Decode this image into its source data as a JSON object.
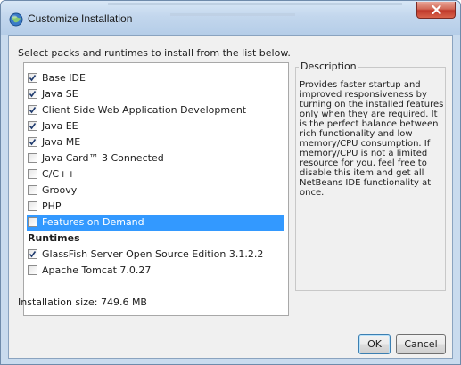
{
  "window": {
    "title": "Customize Installation",
    "app_icon": "globe-icon",
    "close_icon": "close-icon"
  },
  "instructions": "Select packs and runtimes to install from the list below.",
  "packs": [
    {
      "label": "Base IDE",
      "checked": true
    },
    {
      "label": "Java SE",
      "checked": true
    },
    {
      "label": "Client Side Web Application Development",
      "checked": true
    },
    {
      "label": "Java EE",
      "checked": true
    },
    {
      "label": "Java ME",
      "checked": true
    },
    {
      "label": "Java Card™ 3 Connected",
      "checked": false
    },
    {
      "label": "C/C++",
      "checked": false
    },
    {
      "label": "Groovy",
      "checked": false
    },
    {
      "label": "PHP",
      "checked": false
    },
    {
      "label": "Features on Demand",
      "checked": false,
      "selected": true
    }
  ],
  "runtimes_heading": "Runtimes",
  "runtimes": [
    {
      "label": "GlassFish Server Open Source Edition 3.1.2.2",
      "checked": true
    },
    {
      "label": "Apache Tomcat 7.0.27",
      "checked": false
    }
  ],
  "description": {
    "title": "Description",
    "text": "Provides faster startup and improved responsiveness by turning on the installed features only when they are required. It is the perfect balance between rich functionality and low memory/CPU consumption. If memory/CPU is not a limited resource for you, feel free to disable this item and get all NetBeans IDE functionality at once."
  },
  "installation_size": "Installation size: 749.6 MB",
  "buttons": {
    "ok": "OK",
    "cancel": "Cancel"
  },
  "colors": {
    "selection": "#3399ff",
    "title_bar": "#c3d7ed",
    "close_button": "#c0392b",
    "dialog_background": "#f0f0f0"
  }
}
